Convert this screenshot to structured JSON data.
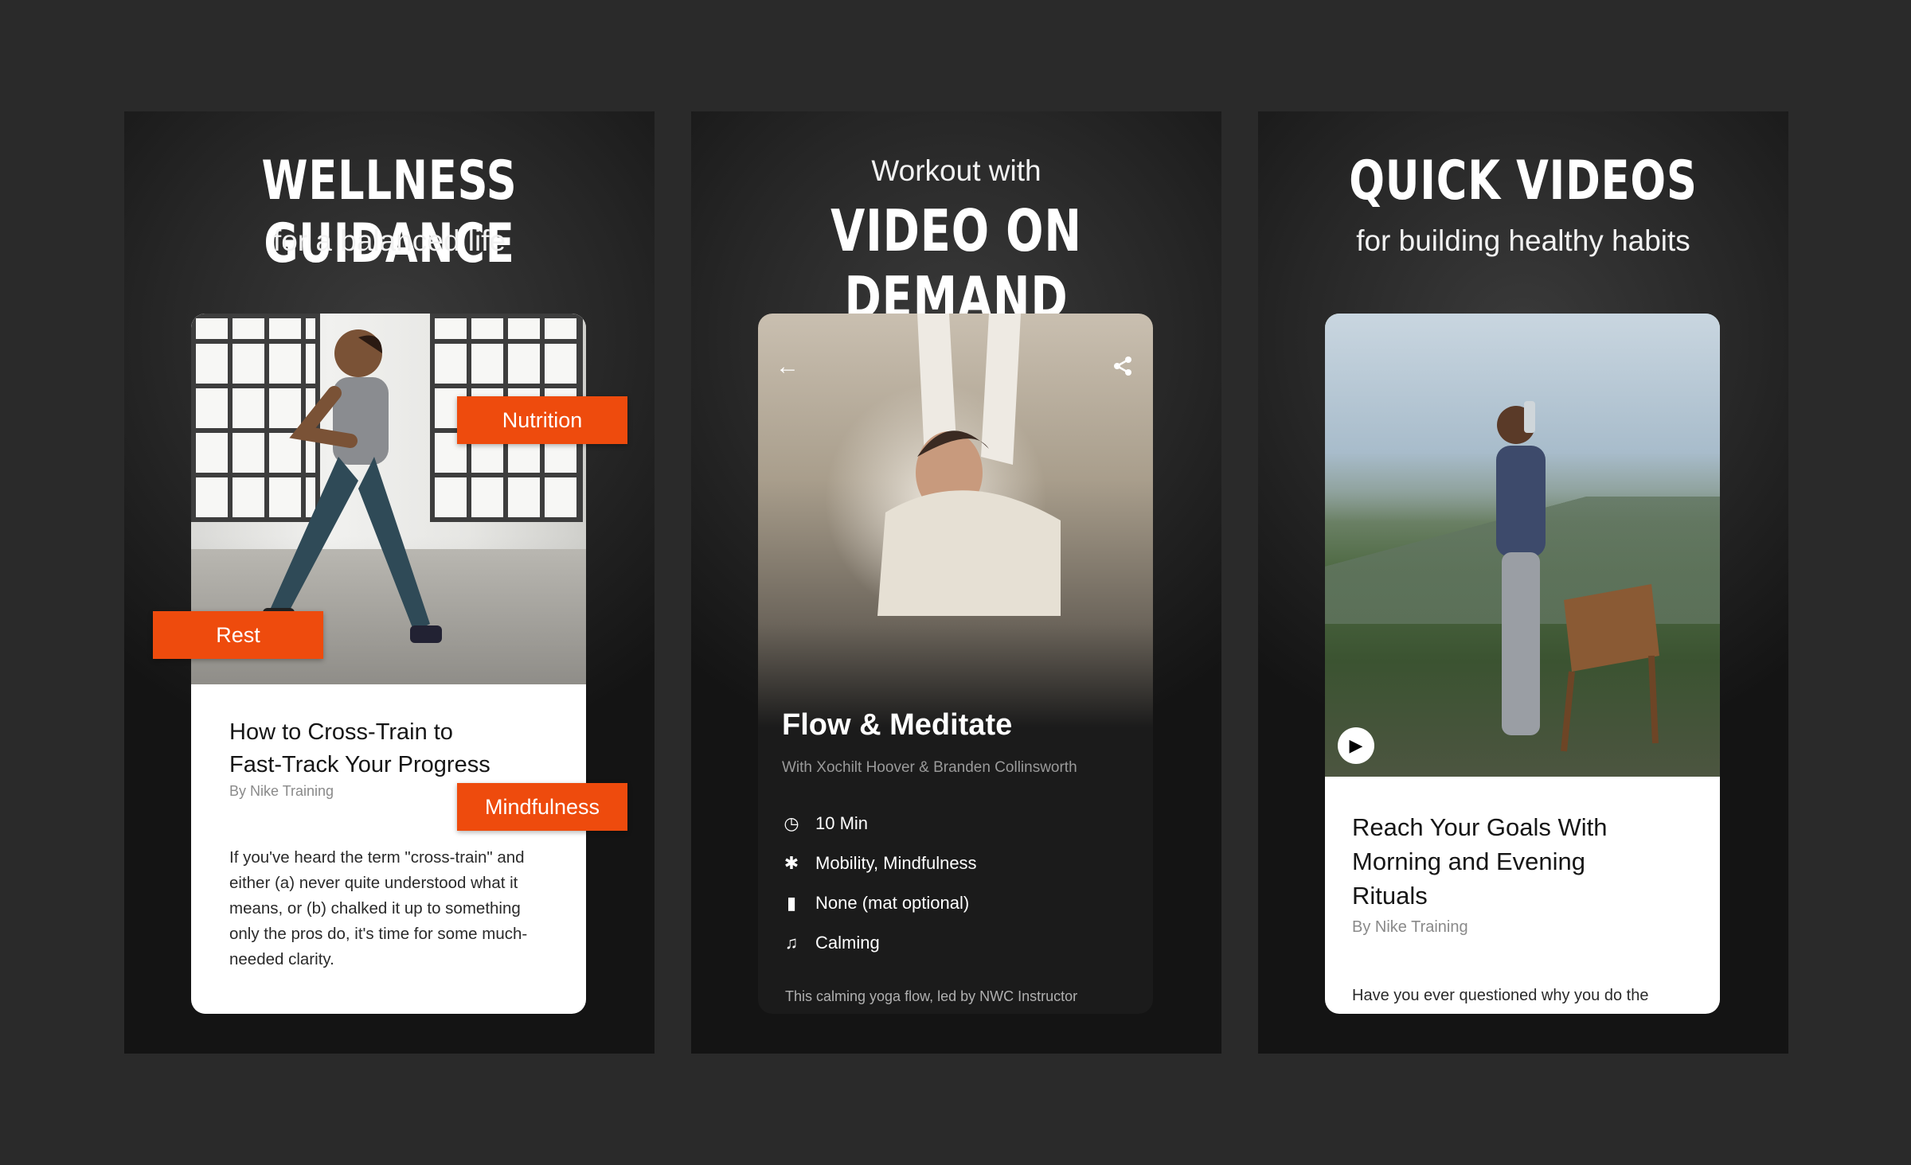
{
  "colors": {
    "accent": "#ee4b0d",
    "background": "#2a2a2a"
  },
  "panel1": {
    "headline": "WELLNESS GUIDANCE",
    "subline": "for a balanced life",
    "card": {
      "title_line1": "How to Cross-Train to",
      "title_line2": "Fast-Track Your Progress",
      "byline": "By Nike Training",
      "body": "If you've heard the term \"cross-train\" and either (a) never quite understood what it means, or (b) chalked it up to something only the pros do, it's time for some much-needed clarity."
    },
    "tags": {
      "nutrition": "Nutrition",
      "rest": "Rest",
      "mindfulness": "Mindfulness"
    }
  },
  "panel2": {
    "subline": "Workout with",
    "headline": "VIDEO ON DEMAND",
    "card": {
      "title": "Flow & Meditate",
      "with": "With Xochilt Hoover & Branden Collinsworth",
      "meta": {
        "duration": "10 Min",
        "focus": "Mobility, Mindfulness",
        "equipment": "None (mat optional)",
        "music": "Calming"
      },
      "description": "This calming yoga flow, led by NWC Instructor"
    },
    "icons": {
      "back": "arrow-left-icon",
      "share": "share-icon",
      "timer": "timer-icon",
      "figure": "person-icon",
      "equipment": "kettlebell-icon",
      "music": "music-icon"
    }
  },
  "panel3": {
    "headline": "QUICK VIDEOS",
    "subline": "for building healthy habits",
    "card": {
      "title_line1": "Reach Your Goals With",
      "title_line2": "Morning and Evening",
      "title_line3": "Rituals",
      "byline": "By Nike Training",
      "body": "Have you ever questioned why you do the"
    }
  }
}
